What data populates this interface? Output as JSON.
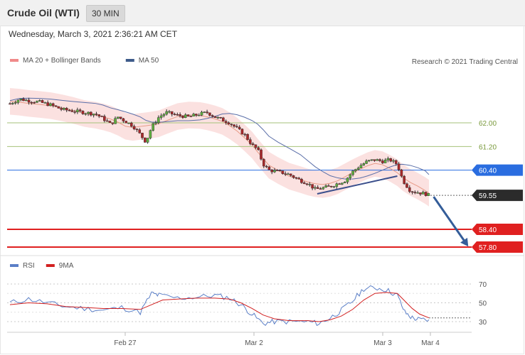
{
  "header": {
    "title": "Crude Oil (WTI)",
    "timeframe": "30 MIN"
  },
  "timestamp": "Wednesday, March 3, 2021 2:36:21 AM CET",
  "chart_data": [
    {
      "type": "candlestick",
      "legend": [
        {
          "name": "MA 20 + Bollinger Bands",
          "color": "#f08a8a"
        },
        {
          "name": "MA 50",
          "color": "#3d5a8a"
        }
      ],
      "credit": "Research © 2021 Trading Central",
      "x_ticks": [
        "Feb 27",
        "Mar 2",
        "Mar 3",
        "Mar 4"
      ],
      "ylim": [
        57.6,
        63.5
      ],
      "close_path": [
        [
          0,
          62.65
        ],
        [
          5,
          62.8
        ],
        [
          10,
          62.75
        ],
        [
          16,
          62.7
        ],
        [
          22,
          62.6
        ],
        [
          28,
          62.45
        ],
        [
          34,
          62.4
        ],
        [
          40,
          62.35
        ],
        [
          46,
          62.3
        ],
        [
          50,
          62.15
        ],
        [
          54,
          61.95
        ],
        [
          58,
          62.2
        ],
        [
          62,
          62.05
        ],
        [
          66,
          61.9
        ],
        [
          70,
          61.6
        ],
        [
          73,
          61.35
        ],
        [
          76,
          61.85
        ],
        [
          80,
          62.2
        ],
        [
          84,
          62.35
        ],
        [
          90,
          62.25
        ],
        [
          96,
          62.2
        ],
        [
          102,
          62.3
        ],
        [
          106,
          62.35
        ],
        [
          110,
          62.2
        ],
        [
          114,
          62.1
        ],
        [
          118,
          62.0
        ],
        [
          122,
          61.8
        ],
        [
          126,
          61.6
        ],
        [
          130,
          61.25
        ],
        [
          133,
          61.1
        ],
        [
          136,
          60.6
        ],
        [
          139,
          60.4
        ],
        [
          144,
          60.35
        ],
        [
          150,
          60.25
        ],
        [
          156,
          60.05
        ],
        [
          160,
          59.95
        ],
        [
          164,
          59.75
        ],
        [
          168,
          59.8
        ],
        [
          172,
          59.85
        ],
        [
          176,
          59.95
        ],
        [
          180,
          60.05
        ],
        [
          184,
          60.35
        ],
        [
          188,
          60.55
        ],
        [
          192,
          60.7
        ],
        [
          196,
          60.75
        ],
        [
          200,
          60.7
        ],
        [
          204,
          60.75
        ],
        [
          208,
          60.6
        ],
        [
          211,
          60.05
        ],
        [
          215,
          59.7
        ],
        [
          219,
          59.65
        ],
        [
          223,
          59.6
        ],
        [
          225,
          59.55
        ]
      ],
      "levels": [
        {
          "value": 62.0,
          "label": "62.00",
          "color": "#7a9a3c",
          "style": "line"
        },
        {
          "value": 61.2,
          "label": "61.20",
          "color": "#7a9a3c",
          "style": "line"
        },
        {
          "value": 60.4,
          "label": "60.40",
          "color": "#2a6de0",
          "style": "badge"
        },
        {
          "value": 59.55,
          "label": "59.55",
          "color": "#2b2b2b",
          "style": "badge"
        },
        {
          "value": 58.4,
          "label": "58.40",
          "color": "#e02020",
          "style": "badge"
        },
        {
          "value": 57.8,
          "label": "57.80",
          "color": "#e02020",
          "style": "badge"
        }
      ],
      "trendline": {
        "from": [
          165,
          59.6
        ],
        "to": [
          208,
          60.2
        ]
      },
      "forecast_arrow": {
        "from": [
          226,
          59.55
        ],
        "to": [
          254,
          57.8
        ]
      }
    },
    {
      "type": "line",
      "legend": [
        {
          "name": "RSI",
          "color": "#5b7fc7"
        },
        {
          "name": "9MA",
          "color": "#d22020"
        }
      ],
      "ylim": [
        20,
        80
      ],
      "y_ticks": [
        "70",
        "50",
        "30"
      ],
      "series": [
        {
          "name": "RSI",
          "values": [
            [
              0,
              50
            ],
            [
              10,
              54
            ],
            [
              20,
              50
            ],
            [
              30,
              46
            ],
            [
              40,
              44
            ],
            [
              50,
              42
            ],
            [
              60,
              45
            ],
            [
              70,
              40
            ],
            [
              76,
              60
            ],
            [
              80,
              58
            ],
            [
              90,
              55
            ],
            [
              100,
              56
            ],
            [
              110,
              58
            ],
            [
              118,
              55
            ],
            [
              124,
              48
            ],
            [
              130,
              38
            ],
            [
              136,
              28
            ],
            [
              142,
              30
            ],
            [
              150,
              30
            ],
            [
              160,
              30
            ],
            [
              166,
              28
            ],
            [
              172,
              34
            ],
            [
              178,
              42
            ],
            [
              184,
              52
            ],
            [
              190,
              65
            ],
            [
              196,
              66
            ],
            [
              202,
              64
            ],
            [
              208,
              58
            ],
            [
              212,
              40
            ],
            [
              216,
              34
            ],
            [
              220,
              32
            ],
            [
              225,
              32
            ]
          ]
        },
        {
          "name": "9MA",
          "values": [
            [
              0,
              48
            ],
            [
              10,
              50
            ],
            [
              20,
              49
            ],
            [
              30,
              46
            ],
            [
              40,
              45
            ],
            [
              50,
              44
            ],
            [
              60,
              44
            ],
            [
              70,
              43
            ],
            [
              76,
              48
            ],
            [
              82,
              53
            ],
            [
              90,
              54
            ],
            [
              100,
              55
            ],
            [
              110,
              55
            ],
            [
              118,
              54
            ],
            [
              124,
              50
            ],
            [
              130,
              44
            ],
            [
              136,
              37
            ],
            [
              142,
              33
            ],
            [
              150,
              31
            ],
            [
              160,
              31
            ],
            [
              166,
              30
            ],
            [
              172,
              32
            ],
            [
              178,
              36
            ],
            [
              184,
              43
            ],
            [
              190,
              53
            ],
            [
              196,
              60
            ],
            [
              202,
              61
            ],
            [
              208,
              60
            ],
            [
              212,
              52
            ],
            [
              216,
              44
            ],
            [
              220,
              38
            ],
            [
              225,
              34
            ]
          ]
        }
      ],
      "current_value": 34
    }
  ]
}
